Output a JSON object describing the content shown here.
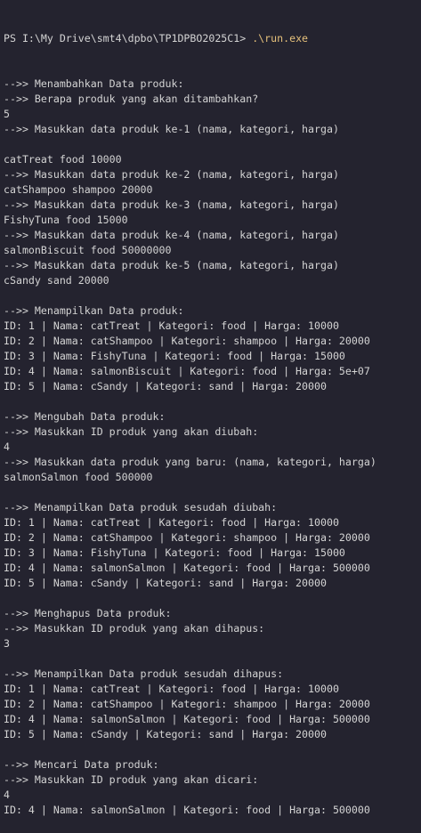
{
  "terminal": {
    "prompt": "PS I:\\My Drive\\smt4\\dpbo\\TP1DPBO2025C1> ",
    "command": ".\\run.exe",
    "command_color": "#e5c07b",
    "lines": [
      "-->> Menambahkan Data produk:",
      "-->> Berapa produk yang akan ditambahkan?",
      "5",
      "-->> Masukkan data produk ke-1 (nama, kategori, harga)",
      "",
      "catTreat food 10000",
      "-->> Masukkan data produk ke-2 (nama, kategori, harga)",
      "catShampoo shampoo 20000",
      "-->> Masukkan data produk ke-3 (nama, kategori, harga)",
      "FishyTuna food 15000",
      "-->> Masukkan data produk ke-4 (nama, kategori, harga)",
      "salmonBiscuit food 50000000",
      "-->> Masukkan data produk ke-5 (nama, kategori, harga)",
      "cSandy sand 20000",
      "",
      "-->> Menampilkan Data produk:",
      "ID: 1 | Nama: catTreat | Kategori: food | Harga: 10000",
      "ID: 2 | Nama: catShampoo | Kategori: shampoo | Harga: 20000",
      "ID: 3 | Nama: FishyTuna | Kategori: food | Harga: 15000",
      "ID: 4 | Nama: salmonBiscuit | Kategori: food | Harga: 5e+07",
      "ID: 5 | Nama: cSandy | Kategori: sand | Harga: 20000",
      "",
      "-->> Mengubah Data produk:",
      "-->> Masukkan ID produk yang akan diubah:",
      "4",
      "-->> Masukkan data produk yang baru: (nama, kategori, harga)",
      "salmonSalmon food 500000",
      "",
      "-->> Menampilkan Data produk sesudah diubah:",
      "ID: 1 | Nama: catTreat | Kategori: food | Harga: 10000",
      "ID: 2 | Nama: catShampoo | Kategori: shampoo | Harga: 20000",
      "ID: 3 | Nama: FishyTuna | Kategori: food | Harga: 15000",
      "ID: 4 | Nama: salmonSalmon | Kategori: food | Harga: 500000",
      "ID: 5 | Nama: cSandy | Kategori: sand | Harga: 20000",
      "",
      "-->> Menghapus Data produk:",
      "-->> Masukkan ID produk yang akan dihapus:",
      "3",
      "",
      "-->> Menampilkan Data produk sesudah dihapus:",
      "ID: 1 | Nama: catTreat | Kategori: food | Harga: 10000",
      "ID: 2 | Nama: catShampoo | Kategori: shampoo | Harga: 20000",
      "ID: 4 | Nama: salmonSalmon | Kategori: food | Harga: 500000",
      "ID: 5 | Nama: cSandy | Kategori: sand | Harga: 20000",
      "",
      "-->> Mencari Data produk:",
      "-->> Masukkan ID produk yang akan dicari:",
      "4",
      "ID: 4 | Nama: salmonSalmon | Kategori: food | Harga: 500000"
    ]
  }
}
